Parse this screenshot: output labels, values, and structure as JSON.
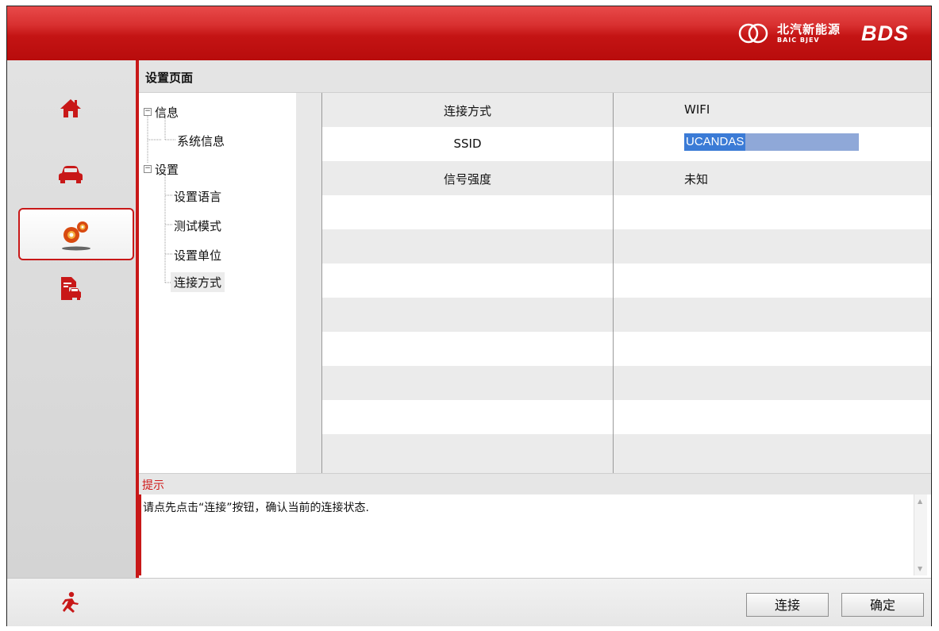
{
  "header": {
    "brand_cn": "北汽新能源",
    "brand_en": "BAIC BJEV",
    "product": "BDS",
    "accent_color": "#c81818"
  },
  "sidebar": {
    "items": [
      {
        "icon": "home-icon",
        "active": false
      },
      {
        "icon": "car-icon",
        "active": false
      },
      {
        "icon": "settings-gears-icon",
        "active": true
      },
      {
        "icon": "report-car-icon",
        "active": false
      }
    ]
  },
  "page": {
    "title": "设置页面"
  },
  "tree": {
    "info": "信息",
    "system_info": "系统信息",
    "settings": "设置",
    "language": "设置语言",
    "test_mode": "测试模式",
    "units": "设置单位",
    "connection": "连接方式"
  },
  "grid": {
    "rows": [
      {
        "label": "连接方式",
        "value": "WIFI"
      },
      {
        "label": "SSID",
        "value": "UCANDAS"
      },
      {
        "label": "信号强度",
        "value": "未知"
      }
    ]
  },
  "hint": {
    "title": "提示",
    "text": "请点先点击“连接”按钮，确认当前的连接状态."
  },
  "buttons": {
    "connect": "连接",
    "confirm": "确定"
  }
}
